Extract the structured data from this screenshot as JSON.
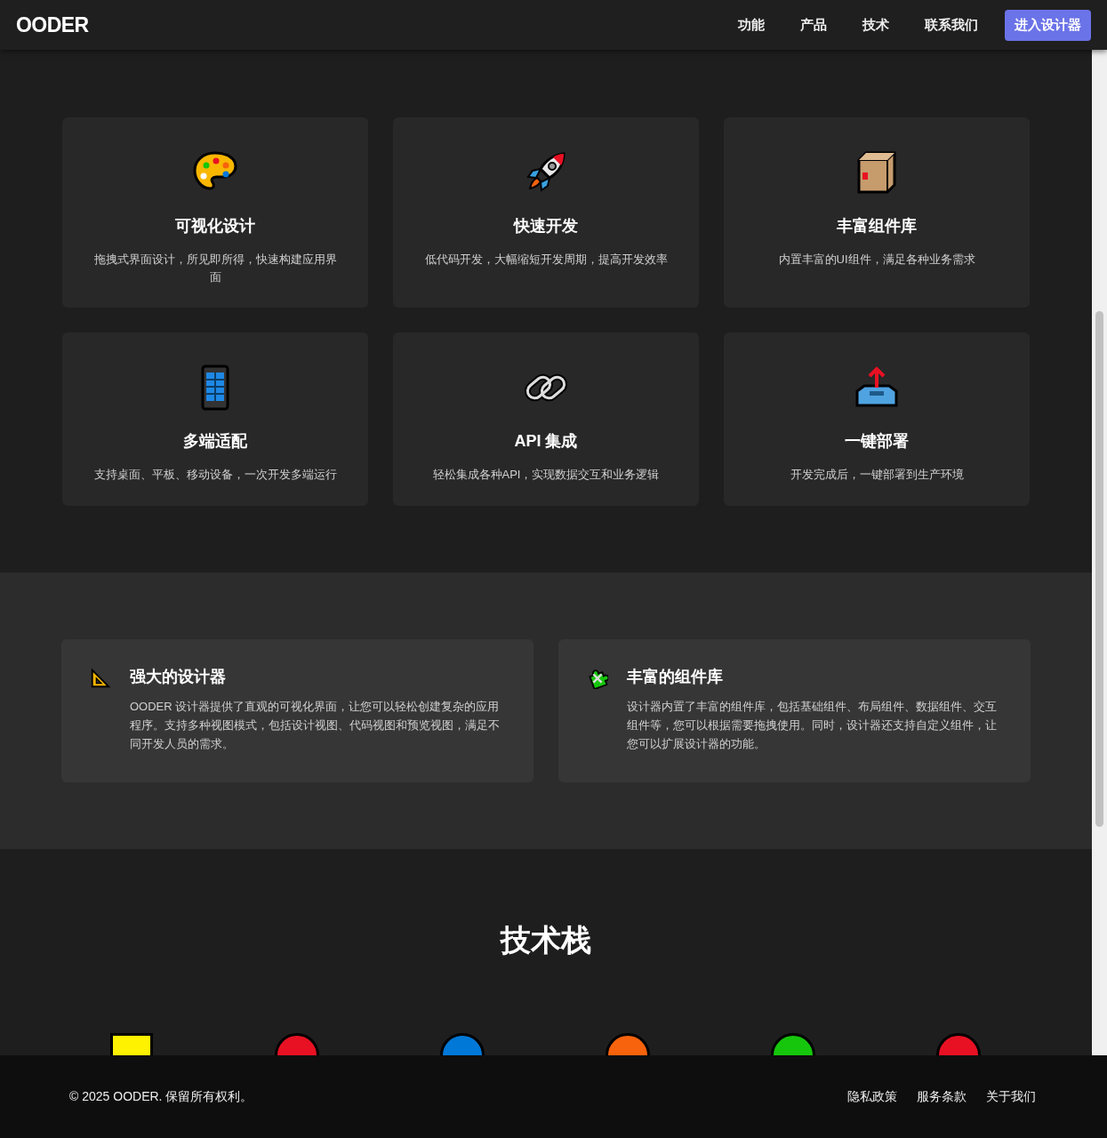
{
  "header": {
    "logo": "OODER",
    "nav": [
      "功能",
      "产品",
      "技术",
      "联系我们"
    ],
    "cta": "进入设计器"
  },
  "features": {
    "cards": [
      {
        "kind": "palette",
        "title": "可视化设计",
        "description": "拖拽式界面设计，所见即所得，快速构建应用界面"
      },
      {
        "kind": "rocket",
        "title": "快速开发",
        "description": "低代码开发，大幅缩短开发周期，提高开发效率"
      },
      {
        "kind": "box",
        "title": "丰富组件库",
        "description": "内置丰富的UI组件，满足各种业务需求"
      },
      {
        "kind": "phone",
        "title": "多端适配",
        "description": "支持桌面、平板、移动设备，一次开发多端运行"
      },
      {
        "kind": "link",
        "title": "API 集成",
        "description": "轻松集成各种API，实现数据交互和业务逻辑"
      },
      {
        "kind": "outbox",
        "title": "一键部署",
        "description": "开发完成后，一键部署到生产环境"
      }
    ]
  },
  "highlights": [
    {
      "kind": "ruler",
      "title": "强大的设计器",
      "description": "OODER 设计器提供了直观的可视化界面，让您可以轻松创建复杂的应用程序。支持多种视图模式，包括设计视图、代码视图和预览视图，满足不同开发人员的需求。"
    },
    {
      "kind": "puzzle",
      "title": "丰富的组件库",
      "description": "设计器内置了丰富的组件库，包括基础组件、布局组件、数据组件、交互组件等，您可以根据需要拖拽使用。同时，设计器还支持自定义组件，让您可以扩展设计器的功能。"
    }
  ],
  "tech_stack": {
    "title": "技术栈",
    "items": [
      {
        "kind": "square",
        "color": "#fff200"
      },
      {
        "kind": "circle",
        "color": "#e81123"
      },
      {
        "kind": "circle",
        "color": "#0078d7"
      },
      {
        "kind": "circle",
        "color": "#f7630c"
      },
      {
        "kind": "circle",
        "color": "#16c60c"
      },
      {
        "kind": "circle",
        "color": "#e81123"
      }
    ]
  },
  "footer": {
    "copyright": "© 2025 OODER. 保留所有权利。",
    "links": [
      "隐私政策",
      "服务条款",
      "关于我们"
    ]
  }
}
